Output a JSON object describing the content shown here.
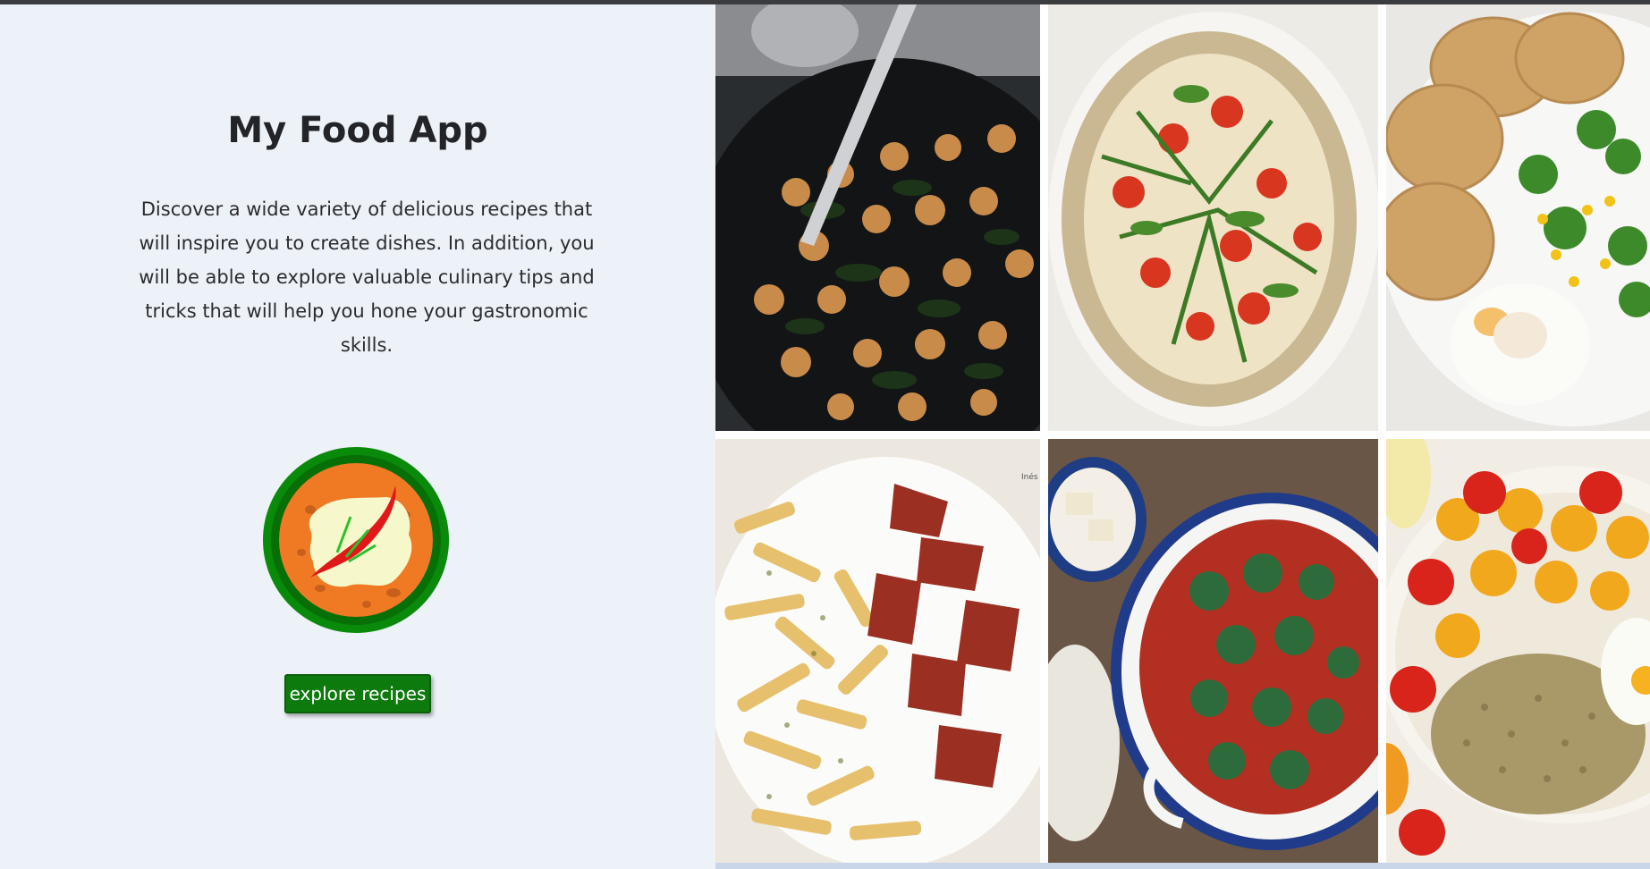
{
  "app": {
    "title": "My Food App",
    "description": "Discover a wide variety of delicious recipes that will inspire you to create dishes. In addition, you will be able to explore valuable culinary tips and tricks that will help you hone your gastronomic skills.",
    "explore_button_label": "explore recipes"
  },
  "gallery": {
    "images": [
      {
        "name": "chickpeas-spinach-dish",
        "icon": "food-photo"
      },
      {
        "name": "hummus-tomato-arugula-flatbread",
        "icon": "food-photo"
      },
      {
        "name": "breaded-eggplant-broccoli-egg",
        "icon": "food-photo"
      },
      {
        "name": "penne-tomato-salad",
        "icon": "food-photo"
      },
      {
        "name": "spinach-balls-tomato-sauce",
        "icon": "food-photo"
      },
      {
        "name": "lentil-cherry-tomato-bowl",
        "icon": "food-photo"
      }
    ],
    "watermark_text": "Inés"
  },
  "colors": {
    "panel_background": "#edf1f8",
    "button_green": "#0c7a0c",
    "logo_ring_green": "#0a8a0a",
    "logo_plate_orange": "#f07a24"
  }
}
